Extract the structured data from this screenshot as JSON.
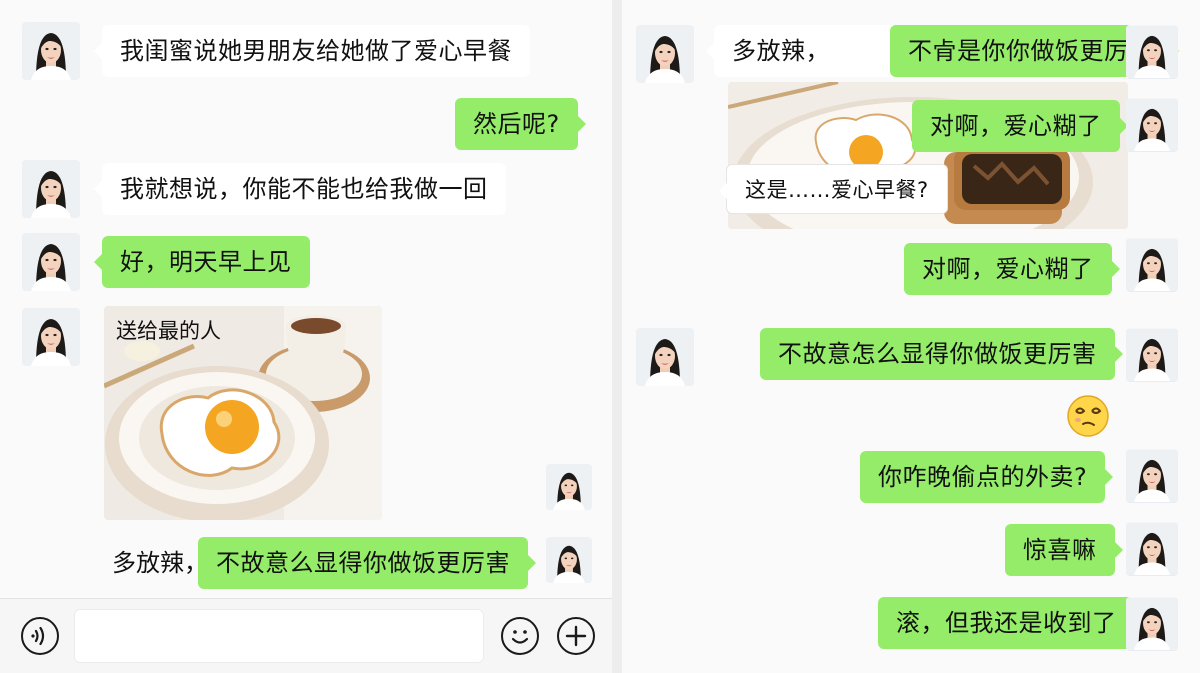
{
  "left": {
    "messages": [
      {
        "text": "我闺蜜说她男朋友给她做了爱心早餐"
      },
      {
        "text": "然后呢?"
      },
      {
        "text": "我就想说，你能不能也给我做一回"
      },
      {
        "text": "好，明天早上见"
      },
      {
        "caption": "送给最的人"
      },
      {
        "prefix": "多放辣，",
        "text": "不故意么显得你做饭更厉害"
      }
    ],
    "input": {
      "value": "",
      "placeholder": ""
    },
    "icons": {
      "voice": "voice-icon",
      "emoji": "emoji-icon",
      "plus": "plus-icon"
    }
  },
  "right": {
    "messages": [
      {
        "prefix": "多放辣，",
        "text": "不肻是你你做饭更厉害"
      },
      {
        "text": "对啊，爱心糊了"
      },
      {
        "text": "这是……爱心早餐?"
      },
      {
        "text": "对啊，爱心糊了"
      },
      {
        "text": "不故意怎么显得你做饭更厉害"
      },
      {
        "sticker": "dizzy-face-emoji"
      },
      {
        "text": "你咋晚偷点的外卖?"
      },
      {
        "text": "惊喜嘛"
      },
      {
        "text": "滚，但我还是收到了"
      }
    ]
  },
  "colors": {
    "green_bubble": "#95ec69",
    "white_bubble": "#ffffff",
    "background": "#fafafa"
  }
}
